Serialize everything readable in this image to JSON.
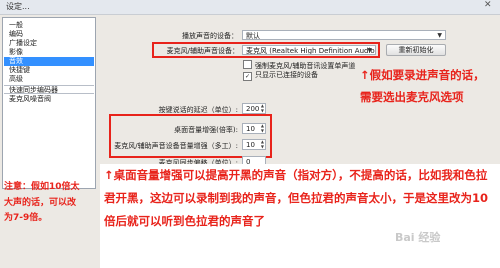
{
  "window": {
    "title": "设定...",
    "close_glyph": "✕"
  },
  "sidebar": {
    "items": [
      {
        "label": "一般"
      },
      {
        "label": "编码"
      },
      {
        "label": "广播设定"
      },
      {
        "label": "影像"
      },
      {
        "label": "音效",
        "selected": true
      },
      {
        "label": "快捷键"
      },
      {
        "label": "高级"
      },
      {
        "label": "快速同步编码器"
      },
      {
        "label": "麦克风噪音阀"
      }
    ]
  },
  "audio": {
    "playback_label": "播放声音的设备：",
    "playback_value": "默认",
    "mic_label": "麦克风/辅助声音设备：",
    "mic_value": "麦克风 (Realtek High Definition Audio)",
    "refresh_button": "重新初始化",
    "checkbox1": "强制麦克风/辅助音讯设置单声道",
    "checkbox2": "只显示已连接的设备",
    "checkbox2_checked": true,
    "ptt_label": "按键说话的延迟（单位）:",
    "ptt_value": "200",
    "desktop_boost_label": "桌面音量增强(倍率):",
    "desktop_boost_value": "10",
    "mic_boost_label": "麦克风/辅助声音设备音量增强（多工）:",
    "mic_boost_value": "10",
    "sync_label": "麦克风同步偏移（单位）:",
    "sync_value": "0"
  },
  "annotations": {
    "arrow_right": "↑假如要录进声音的话，需要选出麦克风选项",
    "note_left": "注意：假如10倍太大声的话，可以改为7-9倍。",
    "bottom": "↑桌面音量增强可以提高开黑的声音（指对方），不提高的话，比如我和色拉君开黑，这边可以录制到我的声音，但色拉君的声音太小，于是这里改为10倍后就可以听到色拉君的声音了"
  },
  "watermark": "Bai 经验"
}
